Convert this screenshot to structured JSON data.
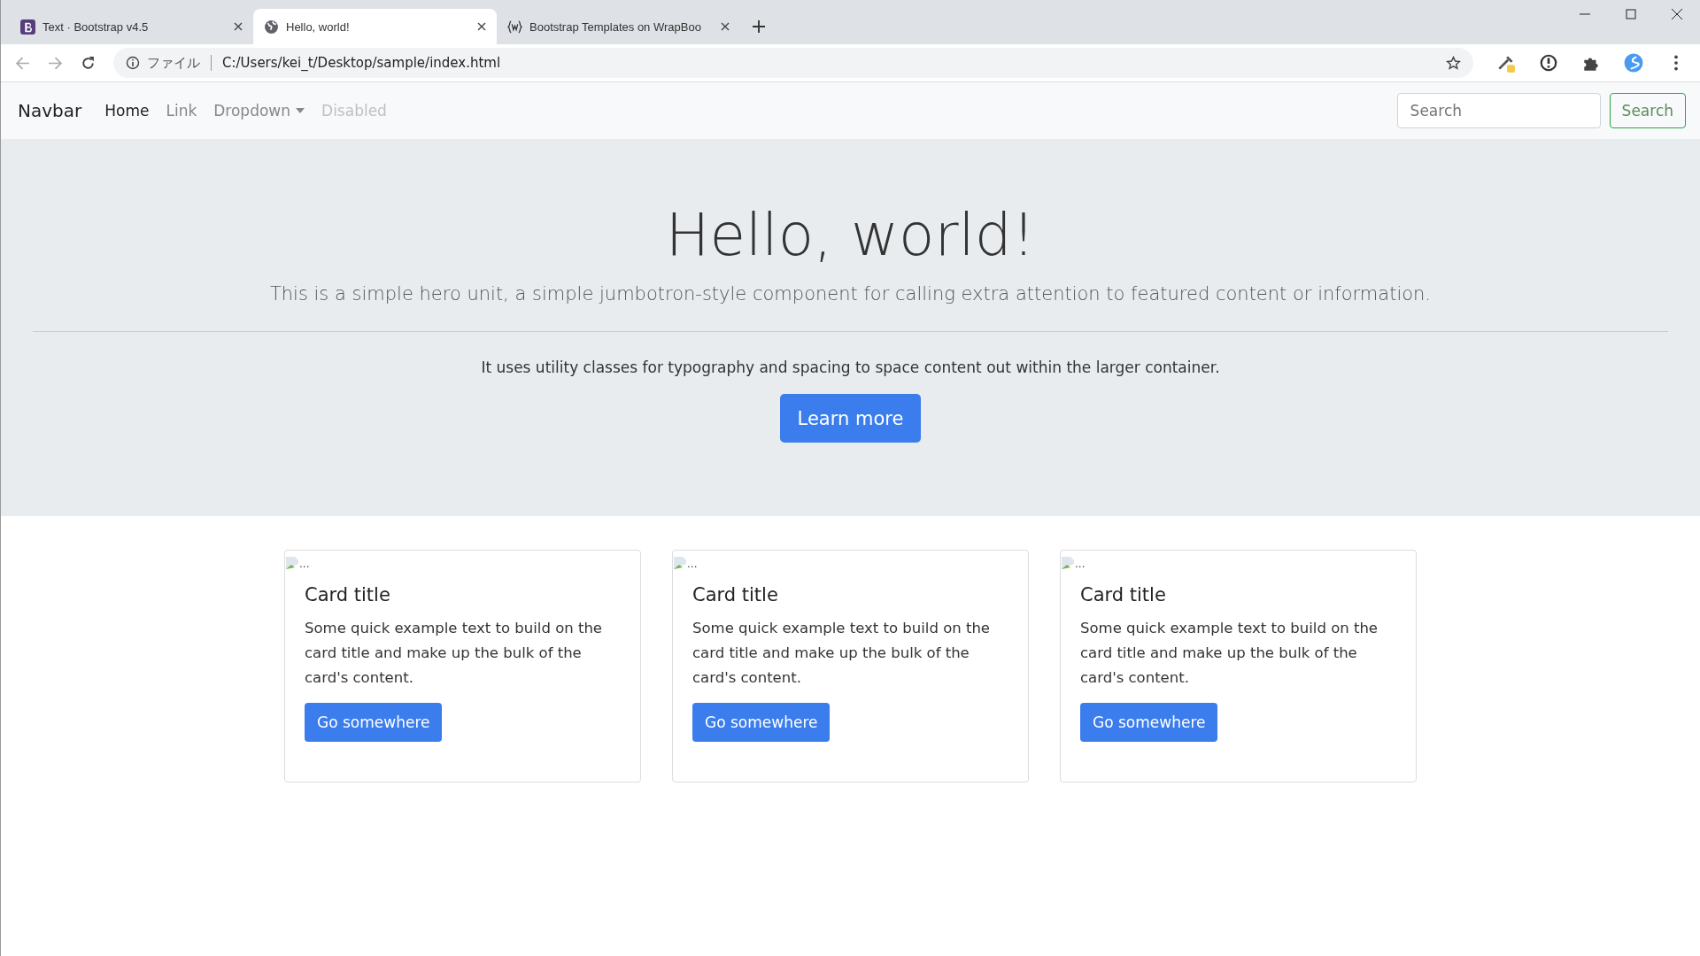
{
  "browser": {
    "tabs": [
      {
        "title": "Text · Bootstrap v4.5",
        "kind": "bootstrap",
        "selected": false
      },
      {
        "title": "Hello, world!",
        "kind": "globe",
        "selected": true
      },
      {
        "title": "Bootstrap Templates on WrapBoo",
        "kind": "wrap",
        "selected": false
      }
    ],
    "address": {
      "scheme_label": "ファイル",
      "url": "C:/Users/kei_t/Desktop/sample/index.html"
    }
  },
  "navbar": {
    "brand": "Navbar",
    "items": [
      {
        "label": "Home",
        "selected": true,
        "disabled": false,
        "dropdown": false
      },
      {
        "label": "Link",
        "selected": false,
        "disabled": false,
        "dropdown": false
      },
      {
        "label": "Dropdown",
        "selected": false,
        "disabled": false,
        "dropdown": true
      },
      {
        "label": "Disabled",
        "selected": false,
        "disabled": true,
        "dropdown": false
      }
    ],
    "search": {
      "placeholder": "Search",
      "button": "Search"
    }
  },
  "hero": {
    "title": "Hello, world!",
    "lead": "This is a simple hero unit, a simple jumbotron-style component for calling extra attention to featured content or information.",
    "text": "It uses utility classes for typography and spacing to space content out within the larger container.",
    "button": "Learn more"
  },
  "cards": [
    {
      "image_alt": "...",
      "title": "Card title",
      "text": "Some quick example text to build on the card title and make up the bulk of the card's content.",
      "button": "Go somewhere"
    },
    {
      "image_alt": "...",
      "title": "Card title",
      "text": "Some quick example text to build on the card title and make up the bulk of the card's content.",
      "button": "Go somewhere"
    },
    {
      "image_alt": "...",
      "title": "Card title",
      "text": "Some quick example text to build on the card title and make up the bulk of the card's content.",
      "button": "Go somewhere"
    }
  ]
}
